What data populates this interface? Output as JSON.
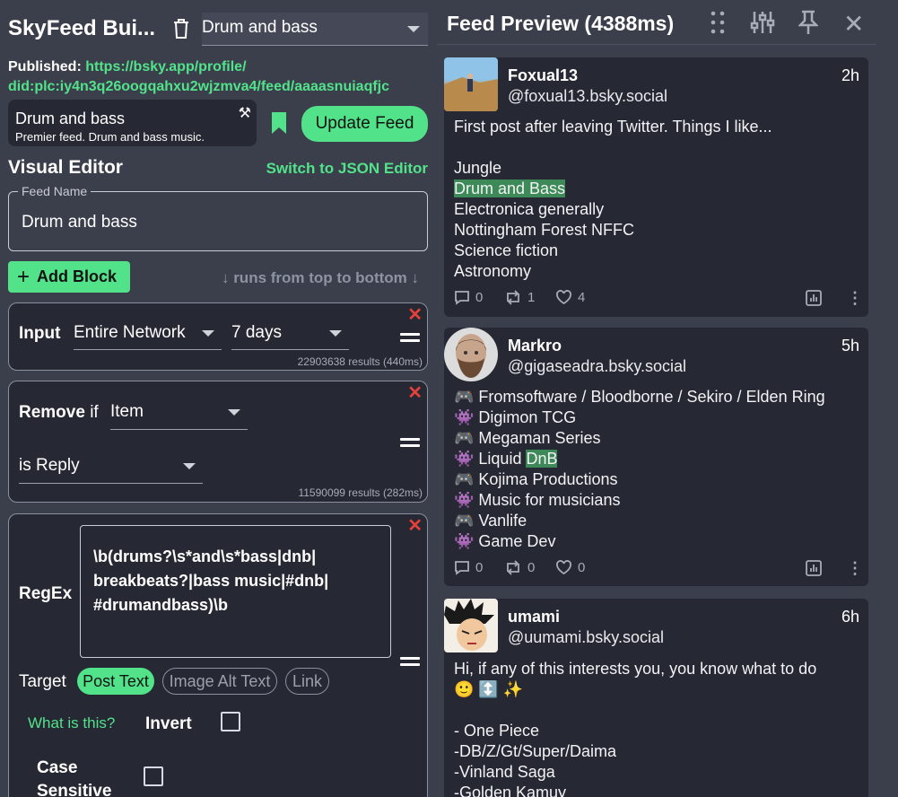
{
  "app": {
    "title": "SkyFeed Bui...",
    "preset_value": "Drum and bass"
  },
  "published": {
    "label": "Published:",
    "url_line1": "https://bsky.app/profile/",
    "url_line2": "did:plc:iy4n3q26oogqahxu2wjzmva4/feed/aaaasnuiaqfjc"
  },
  "feed_info": {
    "name": "Drum and bass",
    "description": "Premier feed. Drum and bass music."
  },
  "update_button": "Update Feed",
  "editor": {
    "title": "Visual Editor",
    "switch_link": "Switch to JSON Editor",
    "feed_name_legend": "Feed Name",
    "feed_name_value": "Drum and bass",
    "add_block": "Add Block",
    "runs_hint": "↓ runs from top to bottom ↓"
  },
  "input_block": {
    "label": "Input",
    "source": "Entire Network",
    "period": "7 days",
    "results": "22903638 results (440ms)"
  },
  "remove_block": {
    "label": "Remove",
    "if_word": "if",
    "subject": "Item",
    "condition": "is Reply",
    "results": "11590099 results (282ms)"
  },
  "regex_block": {
    "label": "RegEx",
    "pattern_line1": "\\b(drums?\\s*and\\s*bass|dnb|",
    "pattern_line2": "breakbeats?|bass music|#dnb|",
    "pattern_line3": "#drumandbass)\\b",
    "target_label": "Target",
    "targets": [
      "Post Text",
      "Image Alt Text",
      "Link"
    ],
    "what_link": "What is this?",
    "invert_label": "Invert",
    "case_label_line1": "Case",
    "case_label_line2": "Sensitive"
  },
  "preview": {
    "title": "Feed Preview (4388ms)"
  },
  "posts": [
    {
      "name": "Foxual13",
      "handle": "@foxual13.bsky.social",
      "time": "2h",
      "lines": [
        "First post after leaving Twitter. Things I like...",
        "",
        "Jungle",
        "Drum and Bass",
        "Electronica generally",
        "Nottingham Forest NFFC",
        "Science fiction",
        "Astronomy"
      ],
      "replies": "0",
      "reposts": "1",
      "likes": "4"
    },
    {
      "name": "Markro",
      "handle": "@gigaseadra.bsky.social",
      "time": "5h",
      "lines": [
        "🎮 Fromsoftware / Bloodborne / Sekiro / Elden Ring",
        "👾 Digimon TCG",
        "🎮 Megaman Series",
        "👾 Liquid ",
        "🎮 Kojima Productions",
        "👾 Music for musicians",
        "🎮 Vanlife",
        "👾 Game Dev"
      ],
      "highlight": "DnB",
      "replies": "0",
      "reposts": "0",
      "likes": "0"
    },
    {
      "name": "umami",
      "handle": "@uumami.bsky.social",
      "time": "6h",
      "lines": [
        "Hi, if any of this interests you, you know what to do",
        "🙂 ↕️ ✨",
        "",
        "- One Piece",
        "-DB/Z/Gt/Super/Daima",
        "-Vinland Saga",
        "-Golden Kamuy"
      ]
    }
  ]
}
